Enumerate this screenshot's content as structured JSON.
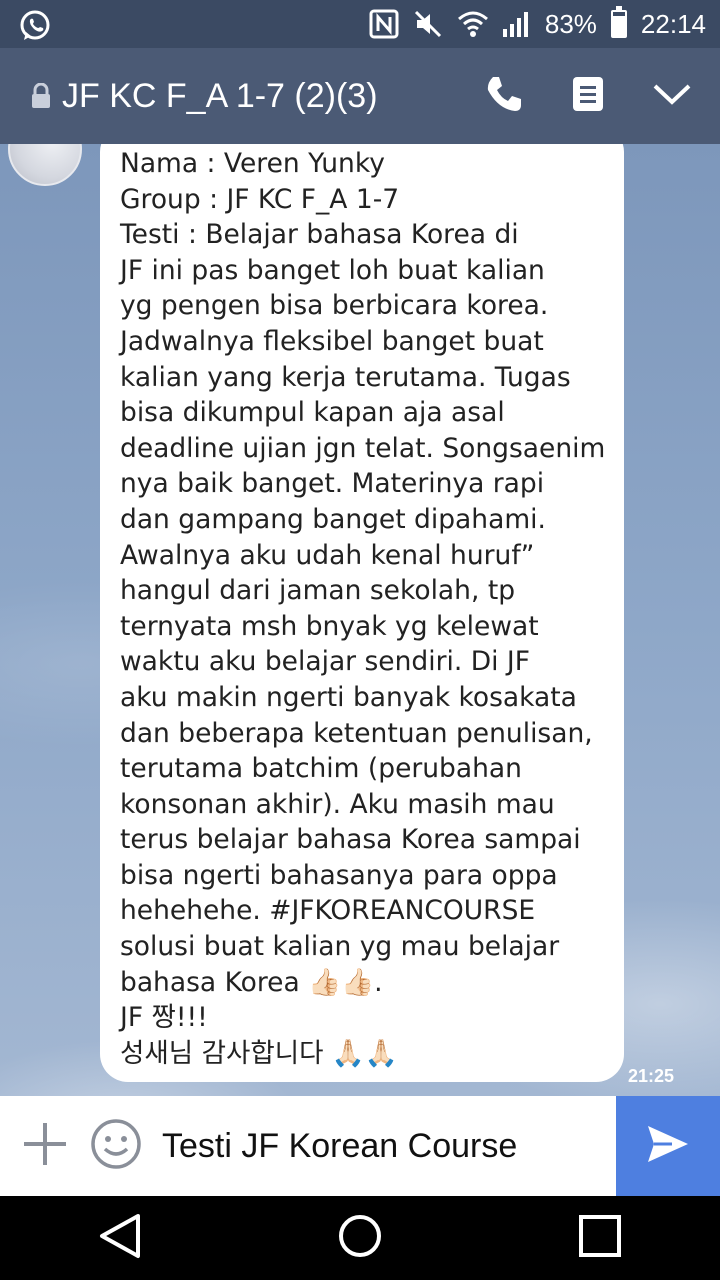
{
  "status_bar": {
    "battery": "83%",
    "battery_level": 0.83,
    "time": "22:14"
  },
  "header": {
    "title": "JF KC F_A 1-7 (2)(3)"
  },
  "message": {
    "text": "Nama : Veren Yunky\nGroup : JF KC F_A 1-7\nTesti : Belajar bahasa Korea di\nJF ini pas banget loh buat kalian\nyg pengen bisa berbicara korea.\nJadwalnya fleksibel banget buat\nkalian yang kerja terutama. Tugas\nbisa dikumpul kapan aja asal\ndeadline ujian jgn telat. Songsaenim\nnya baik banget. Materinya rapi\ndan gampang banget dipahami.\nAwalnya aku udah kenal huruf”\nhangul dari jaman sekolah, tp\nternyata msh bnyak yg kelewat\nwaktu aku belajar sendiri. Di JF\naku makin ngerti banyak kosakata\ndan beberapa ketentuan penulisan,\nterutama batchim (perubahan\nkonsonan akhir). Aku masih mau\nterus belajar bahasa Korea sampai\nbisa ngerti bahasanya para oppa\nhehehehe. #JFKOREANCOURSE\nsolusi buat kalian yg mau belajar\nbahasa Korea 👍🏻👍🏻.\nJF 짱!!!\n성새님 감사합니다 🙏🏻🙏🏻",
    "timestamp": "21:25"
  },
  "input": {
    "value": "Testi JF Korean Course"
  },
  "icons": {
    "status_left": "whatsapp-icon",
    "status_right": [
      "nfc-icon",
      "mute-icon",
      "wifi-icon",
      "signal-icon",
      "battery-icon"
    ],
    "header": [
      "lock-icon",
      "phone-icon",
      "notes-icon",
      "chevron-down-icon"
    ],
    "input": [
      "plus-icon",
      "emoji-icon",
      "send-icon"
    ],
    "nav": [
      "back-icon",
      "home-icon",
      "recents-icon"
    ]
  },
  "colors": {
    "status_bar": "#3b4a63",
    "header": "#4b5a75",
    "send_button": "#4e7fe0",
    "bubble": "#ffffff"
  }
}
